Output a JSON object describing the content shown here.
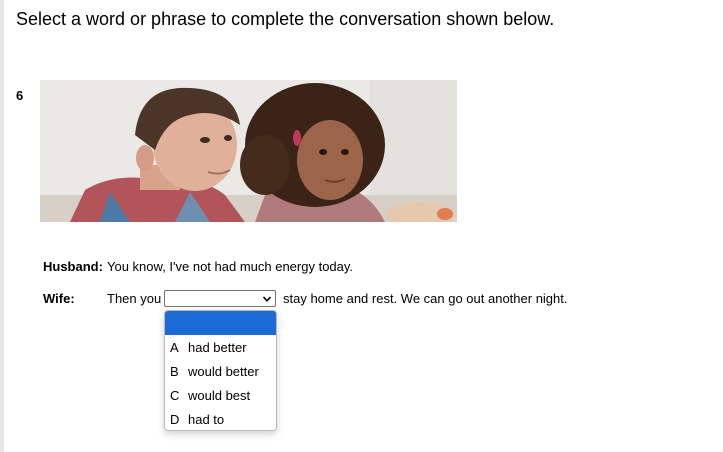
{
  "instruction": "Select a word or phrase to complete the conversation shown below.",
  "question_number": "6",
  "dialogue": {
    "husband": {
      "label": "Husband:",
      "text": "You know, I've not had much energy today."
    },
    "wife": {
      "label": "Wife:",
      "text_before": "Then you",
      "text_after": "stay home and rest. We can go out another night."
    }
  },
  "select": {
    "selected_value": "",
    "open": true
  },
  "options": [
    {
      "letter": "",
      "text": ""
    },
    {
      "letter": "A",
      "text": "had better"
    },
    {
      "letter": "B",
      "text": "would better"
    },
    {
      "letter": "C",
      "text": "would best"
    },
    {
      "letter": "D",
      "text": "had to"
    }
  ],
  "colors": {
    "selected_option": "#1b6ad6",
    "page_bg": "#ffffff",
    "left_bar": "#e6e6e6"
  },
  "icons": {
    "select_arrow": "chevron-down-icon"
  }
}
